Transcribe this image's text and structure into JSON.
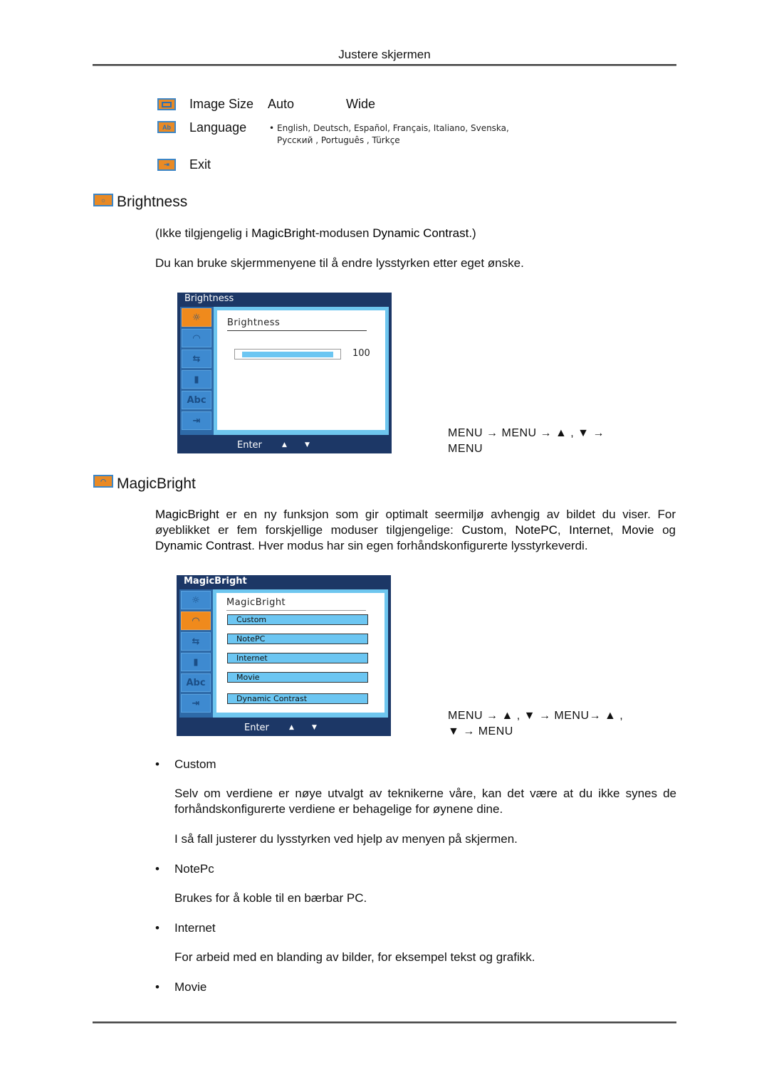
{
  "header": {
    "title": "Justere skjermen"
  },
  "menu_summary": {
    "image_size": {
      "label": "Image Size",
      "options": [
        "Auto",
        "Wide"
      ]
    },
    "language": {
      "label": "Language",
      "bullet": "•",
      "line1": "English, Deutsch, Español, Français,  Italiano, Svenska,",
      "line2": "Русский , Português , Türkçe"
    },
    "exit": {
      "label": "Exit"
    }
  },
  "brightness": {
    "title": "Brightness",
    "note_pre": "(Ikke tilgjengelig i ",
    "note_b1": "MagicBright",
    "note_mid": "-modusen ",
    "note_b2": "Dynamic Contrast",
    "note_post": ".)",
    "description": "Du kan bruke skjermmenyene til å endre lysstyrken etter eget ønske.",
    "osd": {
      "window_title": "Brightness",
      "panel_title": "Brightness",
      "value": "100",
      "level_percent": 100,
      "footer": {
        "enter": "Enter",
        "up": "▲",
        "down": "▼"
      }
    },
    "navigation_line1": "MENU → MENU → ▲ , ▼ →",
    "navigation_line2": "MENU"
  },
  "osd_sidebar": {
    "tabs": [
      {
        "name": "brightness",
        "glyph": "☼"
      },
      {
        "name": "magicbright",
        "glyph": "◠"
      },
      {
        "name": "position",
        "glyph": "⇆"
      },
      {
        "name": "image-size",
        "glyph": "▮"
      },
      {
        "name": "language",
        "glyph": "Abc"
      },
      {
        "name": "exit",
        "glyph": "⇥"
      }
    ]
  },
  "magicbright": {
    "title": "MagicBright",
    "para_b1": "MagicBright",
    "para_t1": " er en ny funksjon som gir optimalt seermiljø avhengig av bildet du viser. For øyeblikket er fem forskjellige moduser tilgjengelige: ",
    "para_b2": "Custom",
    "para_t2": ", ",
    "para_b3": "NotePC",
    "para_t3": ", ",
    "para_b4": "Internet",
    "para_t4": ", ",
    "para_b5": "Movie",
    "para_t5": " og ",
    "para_b6": "Dynamic Contrast",
    "para_t6": ". Hver modus har sin egen forhåndskonfigurerte lysstyrkeverdi.",
    "osd": {
      "window_title": "MagicBright",
      "panel_title": "MagicBright",
      "options": [
        "Custom",
        "NotePC",
        "Internet",
        "Movie",
        "Dynamic Contrast"
      ],
      "footer": {
        "enter": "Enter",
        "up": "▲",
        "down": "▼"
      }
    },
    "navigation_line1": "MENU → ▲ , ▼ → MENU→ ▲ ,",
    "navigation_line2": "▼ → MENU"
  },
  "modes": [
    {
      "name": "Custom",
      "paragraphs": [
        "Selv om verdiene er nøye utvalgt av teknikerne våre, kan det være at du ikke synes de forhåndskonfigurerte verdiene er behagelige for øynene dine.",
        "I så fall justerer du lysstyrken ved hjelp av menyen på skjermen."
      ]
    },
    {
      "name": "NotePc",
      "paragraphs": [
        "Brukes for å koble til en bærbar PC."
      ]
    },
    {
      "name": "Internet",
      "paragraphs": [
        "For arbeid med en blanding av bilder, for eksempel tekst og grafikk."
      ]
    },
    {
      "name": "Movie",
      "paragraphs": []
    }
  ],
  "bullet_char": "•"
}
